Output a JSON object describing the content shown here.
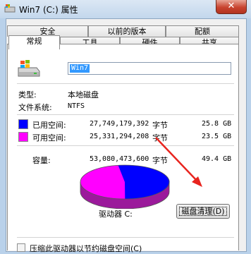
{
  "window": {
    "title": "Win7 (C:) 属性",
    "close_glyph": "✕"
  },
  "tabs_top": [
    {
      "label": "安全"
    },
    {
      "label": "以前的版本"
    },
    {
      "label": "配额"
    }
  ],
  "tabs_bottom": [
    {
      "label": "常规",
      "active": true
    },
    {
      "label": "工具"
    },
    {
      "label": "硬件"
    },
    {
      "label": "共享"
    }
  ],
  "drive_icon": "drive-icon",
  "volume_name": "Win7",
  "info": {
    "type_label": "类型:",
    "type_value": "本地磁盘",
    "fs_label": "文件系统:",
    "fs_value": "NTFS"
  },
  "used": {
    "label": "已用空间:",
    "bytes": "27,749,179,392",
    "unit": "字节",
    "size": "25.8 GB",
    "color": "#0000ff"
  },
  "free": {
    "label": "可用空间:",
    "bytes": "25,331,294,208",
    "unit": "字节",
    "size": "23.5 GB",
    "color": "#ff00ff"
  },
  "capacity": {
    "label": "容量:",
    "bytes": "53,080,473,600",
    "unit": "字节",
    "size": "49.4 GB"
  },
  "drive_label": "驱动器 C:",
  "cleanup_button": "磁盘清理(D)",
  "compress_checkbox": "压缩此驱动器以节约磁盘空间(C)",
  "used_fraction": 0.523,
  "arrow_color": "#e8241e"
}
